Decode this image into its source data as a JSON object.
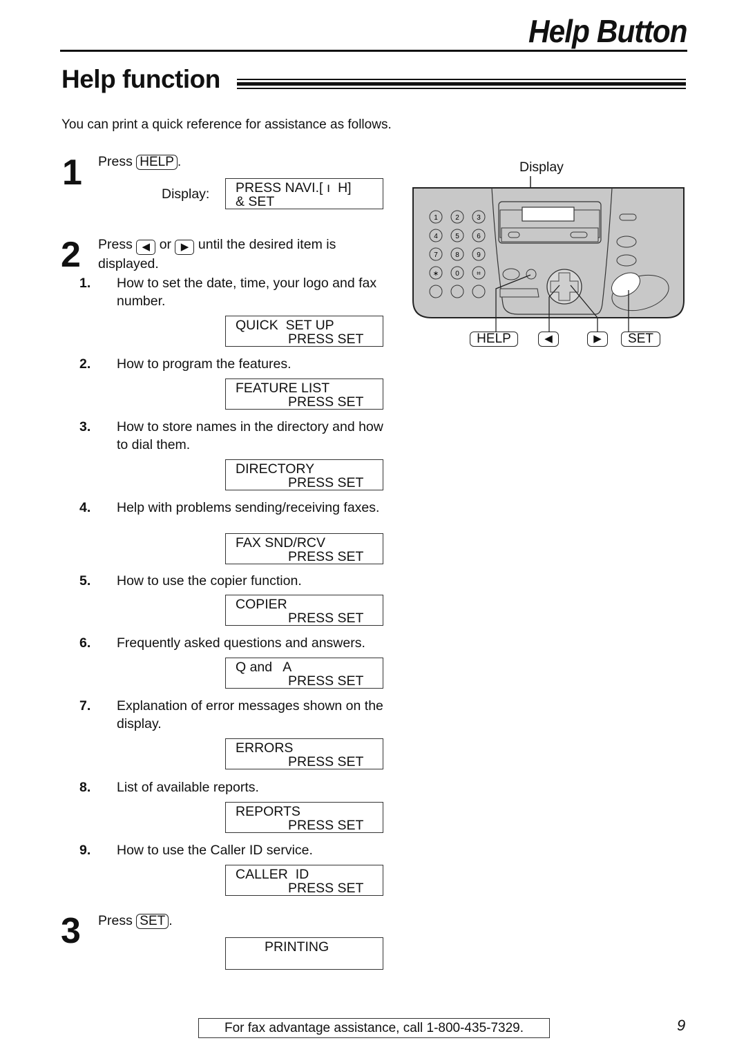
{
  "header": {
    "chapter_title": "Help Button",
    "section_title": "Help function"
  },
  "intro": "You can print a quick reference for assistance as follows.",
  "step1": {
    "number": "1",
    "press_prefix": "Press",
    "key_label": "HELP",
    "suffix": ".",
    "display_label": "Display:",
    "display_line1": "PRESS NAVI.[ ı  H]",
    "display_line2": "& SET"
  },
  "step2": {
    "number": "2",
    "press_prefix": "Press",
    "left_key_icon": "◀",
    "or_text": "or",
    "right_key_icon": "▶",
    "text_after": "until the desired item is",
    "text_line2": "displayed.",
    "items": [
      {
        "num": "1.",
        "text": "How to set the date, time, your logo and fax number.",
        "lcd1": "QUICK  SET UP",
        "lcd2": "PRESS SET"
      },
      {
        "num": "2.",
        "text": "How to program the features.",
        "lcd1": "FEATURE LIST",
        "lcd2": "PRESS SET"
      },
      {
        "num": "3.",
        "text": "How to store names in the directory and how to dial them.",
        "lcd1": "DIRECTORY",
        "lcd2": "PRESS SET"
      },
      {
        "num": "4.",
        "text": "Help with problems sending/receiving faxes.",
        "lcd1": "FAX SND/RCV",
        "lcd2": "PRESS SET"
      },
      {
        "num": "5.",
        "text": "How to use the copier function.",
        "lcd1": "COPIER",
        "lcd2": "PRESS SET"
      },
      {
        "num": "6.",
        "text": "Frequently asked questions and answers.",
        "lcd1": "Q and   A",
        "lcd2": "PRESS SET"
      },
      {
        "num": "7.",
        "text": "Explanation of error messages shown on the display.",
        "lcd1": "ERRORS",
        "lcd2": "PRESS SET"
      },
      {
        "num": "8.",
        "text": "List of available reports.",
        "lcd1": "REPORTS",
        "lcd2": "PRESS SET"
      },
      {
        "num": "9.",
        "text": "How to use the Caller ID service.",
        "lcd1": "CALLER  ID",
        "lcd2": "PRESS SET"
      }
    ]
  },
  "step3": {
    "number": "3",
    "press_prefix": "Press",
    "key_label": "SET",
    "suffix": ".",
    "display_line1": "PRINTING"
  },
  "diagram": {
    "display_callout": "Display",
    "keypad": [
      "1",
      "2",
      "3",
      "4",
      "5",
      "6",
      "7",
      "8",
      "9",
      "∗",
      "0",
      "⌗"
    ],
    "help_key": "HELP",
    "left_key": "◀",
    "right_key": "▶",
    "set_key": "SET",
    "panel_color": "#c8c8c8"
  },
  "footer": {
    "assistance": "For fax advantage assistance, call 1-800-435-7329.",
    "page_number": "9"
  }
}
